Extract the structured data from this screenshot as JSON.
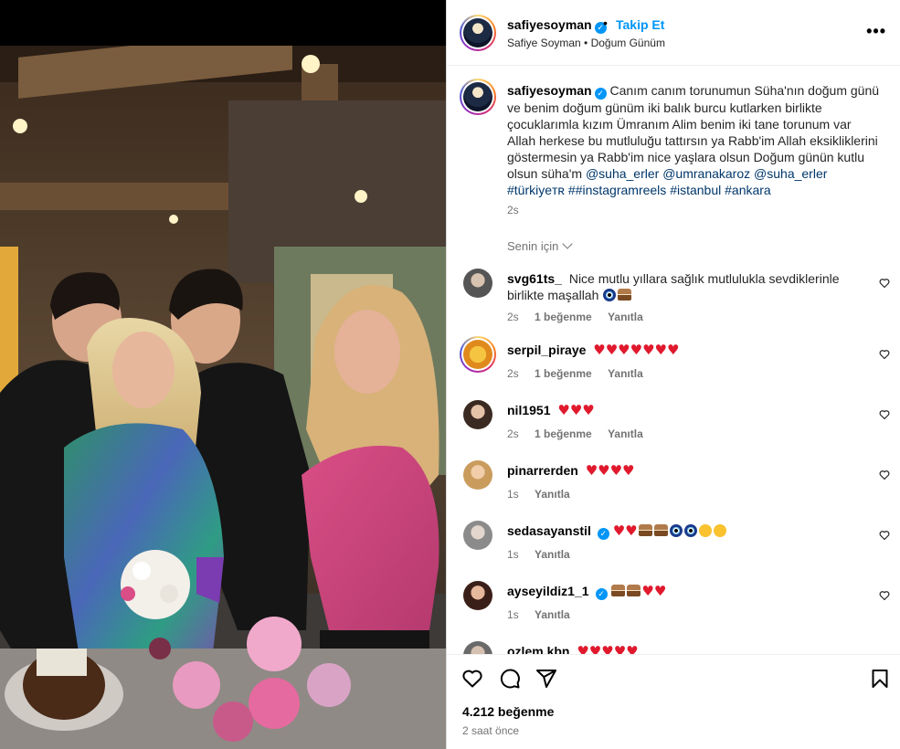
{
  "post": {
    "username": "safiyesoyman",
    "separator": "•",
    "follow_label": "Takip Et",
    "subtitle": "Safiye Soyman • Doğum Günüm",
    "more_label": "•••"
  },
  "caption": {
    "username": "safiyesoyman",
    "text": "Canım canım torunumun Süha'nın doğum günü ve benim doğum günüm iki balık burcu kutlarken birlikte çocuklarımla kızım Ümranım Alim benim iki tane torunum var Allah herkese bu mutluluğu tattırsın ya Rabb'im Allah eksikliklerini göstermesin ya Rabb'im nice yaşlara olsun Doğum günün kutlu olsun süha'm ",
    "tags": [
      "@suha_erler",
      "@umranakaroz",
      "@suha_erler",
      "#türkiyeᴛʀ",
      "##instagramreels",
      "#istanbul",
      "#ankara"
    ],
    "time": "2s"
  },
  "for_you_label": "Senin için",
  "comments": [
    {
      "username": "svg61ts_",
      "text": "Nice mutlu yıllara sağlık mutlulukla sevdiklerinle birlikte maşallah",
      "emoji": [
        "nazar-eye",
        "cake"
      ],
      "time": "2s",
      "likes": "1 beğenme",
      "reply": "Yanıtla"
    },
    {
      "username": "serpil_piraye",
      "text": "",
      "emoji": [
        "heart",
        "heart",
        "heart",
        "heart",
        "heart",
        "heart",
        "heart"
      ],
      "time": "2s",
      "likes": "1 beğenme",
      "reply": "Yanıtla"
    },
    {
      "username": "nil1951",
      "text": "",
      "emoji": [
        "heart",
        "heart",
        "heart"
      ],
      "time": "2s",
      "likes": "1 beğenme",
      "reply": "Yanıtla"
    },
    {
      "username": "pinarrerden",
      "text": "",
      "emoji": [
        "heart",
        "heart",
        "heart",
        "heart"
      ],
      "time": "1s",
      "likes": "",
      "reply": "Yanıtla"
    },
    {
      "username": "sedasayanstil",
      "text": "",
      "emoji": [
        "heart",
        "heart",
        "cake",
        "cake",
        "nazar-eye",
        "nazar-eye",
        "kiss-face",
        "kiss-face"
      ],
      "time": "1s",
      "likes": "",
      "reply": "Yanıtla"
    },
    {
      "username": "ayseyildiz1_1",
      "text": "",
      "emoji": [
        "cake",
        "cake",
        "heart",
        "heart"
      ],
      "time": "1s",
      "likes": "",
      "reply": "Yanıtla"
    },
    {
      "username": "ozlem.kbn",
      "text": "",
      "emoji": [
        "heart",
        "heart",
        "heart",
        "heart",
        "heart"
      ],
      "time": "",
      "likes": "",
      "reply": ""
    }
  ],
  "stats": {
    "likes": "4.212 beğenme",
    "time": "2 saat önce"
  },
  "colors": {
    "link": "#0095f6",
    "tag": "#00376b",
    "muted": "#737373",
    "heart": "#e0192d"
  },
  "icons": [
    "verified-badge-icon",
    "more-options-icon",
    "chevron-down-icon",
    "heart-outline-icon",
    "comment-icon",
    "share-icon",
    "bookmark-icon"
  ]
}
